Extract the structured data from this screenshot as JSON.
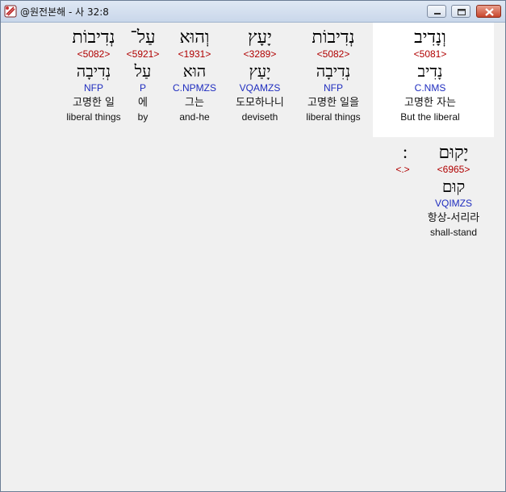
{
  "window": {
    "title": "@원전본해 - 사 32:8"
  },
  "row1": [
    {
      "heb": "נְדִיבוֹת",
      "strong": "<5082>",
      "lemma": "נְדִיבָה",
      "morph": "NFP",
      "kor": "고명한 일",
      "eng": "liberal things"
    },
    {
      "heb": "עַל־",
      "strong": "<5921>",
      "lemma": "עַל",
      "morph": "P",
      "kor": "에",
      "eng": "by"
    },
    {
      "heb": "וְהוּא",
      "strong": "<1931>",
      "lemma": "הוּא",
      "morph": "C.NPMZS",
      "kor": "그는",
      "eng": "and-he"
    },
    {
      "heb": "יָעָץ",
      "strong": "<3289>",
      "lemma": "יָעַץ",
      "morph": "VQAMZS",
      "kor": "도모하나니",
      "eng": "deviseth"
    },
    {
      "heb": "נְדִיבוֹת",
      "strong": "<5082>",
      "lemma": "נְדִיבָה",
      "morph": "NFP",
      "kor": "고명한 일을",
      "eng": "liberal things"
    },
    {
      "heb": "וְנָדִיב",
      "strong": "<5081>",
      "lemma": "נָדִיב",
      "morph": "C.NMS",
      "kor": "고명한 자는",
      "eng": "But the liberal"
    }
  ],
  "row2": [
    {
      "heb": "׃",
      "strong": "<.>"
    },
    {
      "heb": "יָקוּם",
      "strong": "<6965>",
      "lemma": "קוּם",
      "morph": "VQIMZS",
      "kor": "항상-서리라",
      "eng": "shall-stand"
    }
  ]
}
